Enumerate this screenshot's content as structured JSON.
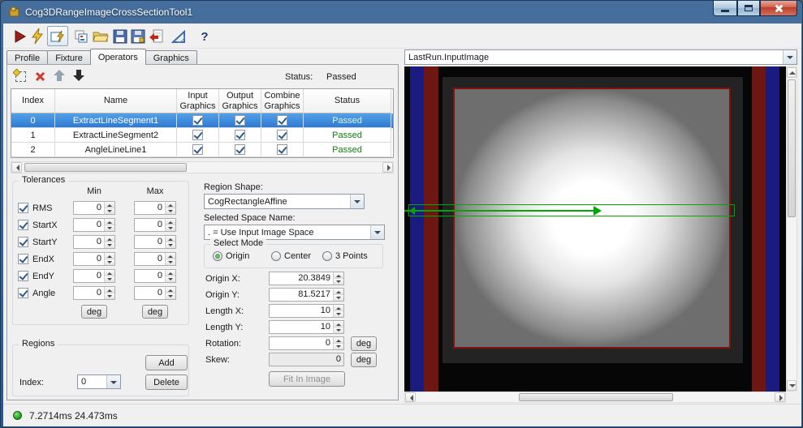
{
  "window": {
    "title": "Cog3DRangeImageCrossSectionTool1"
  },
  "tabs": {
    "items": [
      {
        "label": "Profile"
      },
      {
        "label": "Fixture"
      },
      {
        "label": "Operators"
      },
      {
        "label": "Graphics"
      }
    ]
  },
  "operators": {
    "status_label": "Status:",
    "status_value": "Passed",
    "headers": {
      "index": "Index",
      "name": "Name",
      "input": "Input\nGraphics",
      "output": "Output\nGraphics",
      "combine": "Combine\nGraphics",
      "status": "Status"
    },
    "rows": [
      {
        "index": "0",
        "name": "ExtractLineSegment1",
        "status": "Passed"
      },
      {
        "index": "1",
        "name": "ExtractLineSegment2",
        "status": "Passed"
      },
      {
        "index": "2",
        "name": "AngleLineLine1",
        "status": "Passed"
      }
    ]
  },
  "tolerances": {
    "title": "Tolerances",
    "min": "Min",
    "max": "Max",
    "deg": "deg",
    "rows": [
      {
        "label": "RMS",
        "min": "0",
        "max": "0"
      },
      {
        "label": "StartX",
        "min": "0",
        "max": "0"
      },
      {
        "label": "StartY",
        "min": "0",
        "max": "0"
      },
      {
        "label": "EndX",
        "min": "0",
        "max": "0"
      },
      {
        "label": "EndY",
        "min": "0",
        "max": "0"
      },
      {
        "label": "Angle",
        "min": "0",
        "max": "0"
      }
    ]
  },
  "regions": {
    "title": "Regions",
    "add": "Add",
    "index_label": "Index:",
    "index_value": "0",
    "delete": "Delete"
  },
  "shape": {
    "region_shape_label": "Region Shape:",
    "region_shape_value": "CogRectangleAffine",
    "space_label": "Selected Space Name:",
    "space_value": ". = Use Input Image Space",
    "select_mode_title": "Select Mode",
    "modes": [
      {
        "label": "Origin"
      },
      {
        "label": "Center"
      },
      {
        "label": "3 Points"
      }
    ],
    "fields": [
      {
        "label": "Origin X:",
        "value": "20.3849"
      },
      {
        "label": "Origin Y:",
        "value": "81.5217"
      },
      {
        "label": "Length X:",
        "value": "10"
      },
      {
        "label": "Length Y:",
        "value": "10"
      },
      {
        "label": "Rotation:",
        "value": "0"
      },
      {
        "label": "Skew:",
        "value": "0"
      }
    ],
    "deg": "deg",
    "fit_button": "Fit In Image"
  },
  "display": {
    "source": "LastRun.InputImage"
  },
  "statusbar": {
    "time1": "7.2714ms",
    "time2": "24.473ms"
  },
  "glyphs": {
    "help": "?"
  }
}
